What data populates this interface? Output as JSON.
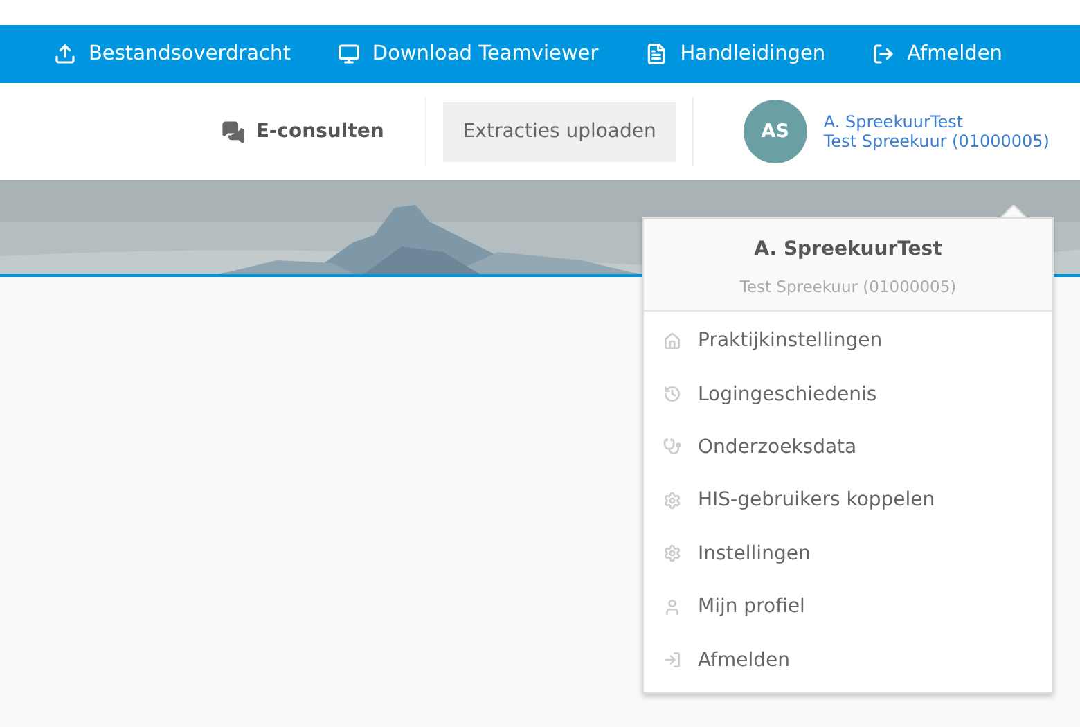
{
  "top_bar": {
    "links": [
      {
        "label": "Bestandsoverdracht"
      },
      {
        "label": "Download Teamviewer"
      },
      {
        "label": "Handleidingen"
      },
      {
        "label": "Afmelden"
      }
    ]
  },
  "header": {
    "econsult": "E-consulten",
    "upload_button": "Extracties uploaden",
    "avatar": "AS",
    "user_name": "A. SpreekuurTest",
    "user_practice": "Test Spreekuur (01000005)"
  },
  "user_menu": {
    "name": "A. SpreekuurTest",
    "practice": "Test Spreekuur (01000005)",
    "items": [
      {
        "label": "Praktijkinstellingen"
      },
      {
        "label": "Logingeschiedenis"
      },
      {
        "label": "Onderzoeksdata"
      },
      {
        "label": "HIS-gebruikers koppelen"
      },
      {
        "label": "Instellingen"
      },
      {
        "label": "Mijn profiel"
      },
      {
        "label": "Afmelden"
      }
    ]
  }
}
